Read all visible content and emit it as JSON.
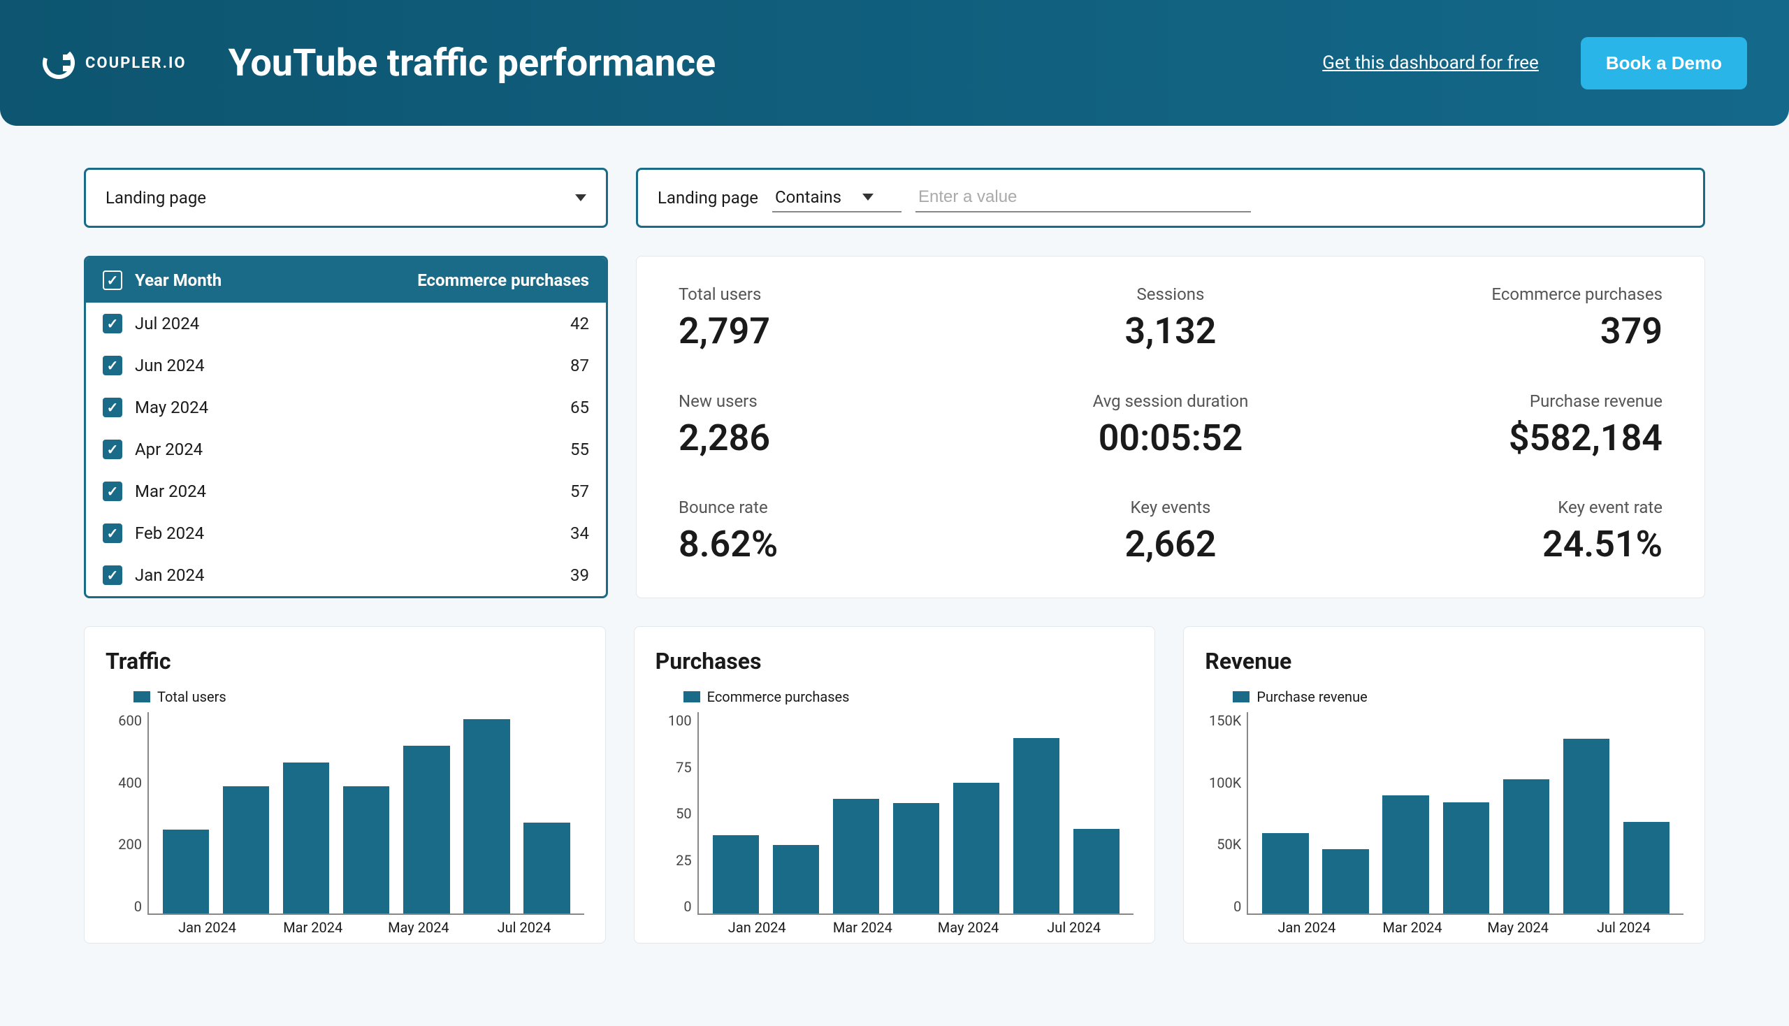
{
  "header": {
    "brand": "COUPLER.IO",
    "title": "YouTube traffic performance",
    "link_label": "Get this dashboard for free",
    "demo_label": "Book a Demo"
  },
  "filters": {
    "dimension_select": "Landing page",
    "condition_dimension": "Landing page",
    "condition_operator": "Contains",
    "condition_placeholder": "Enter a value"
  },
  "month_table": {
    "col_month": "Year Month",
    "col_metric": "Ecommerce purchases",
    "rows": [
      {
        "label": "Jul 2024",
        "value": "42"
      },
      {
        "label": "Jun 2024",
        "value": "87"
      },
      {
        "label": "May 2024",
        "value": "65"
      },
      {
        "label": "Apr 2024",
        "value": "55"
      },
      {
        "label": "Mar 2024",
        "value": "57"
      },
      {
        "label": "Feb 2024",
        "value": "34"
      },
      {
        "label": "Jan 2024",
        "value": "39"
      }
    ]
  },
  "metrics": [
    {
      "label": "Total users",
      "value": "2,797"
    },
    {
      "label": "Sessions",
      "value": "3,132"
    },
    {
      "label": "Ecommerce purchases",
      "value": "379"
    },
    {
      "label": "New users",
      "value": "2,286"
    },
    {
      "label": "Avg session duration",
      "value": "00:05:52"
    },
    {
      "label": "Purchase revenue",
      "value": "$582,184"
    },
    {
      "label": "Bounce rate",
      "value": "8.62%"
    },
    {
      "label": "Key events",
      "value": "2,662"
    },
    {
      "label": "Key event rate",
      "value": "24.51%"
    }
  ],
  "charts": {
    "traffic": {
      "title": "Traffic",
      "legend": "Total users"
    },
    "purchases": {
      "title": "Purchases",
      "legend": "Ecommerce purchases"
    },
    "revenue": {
      "title": "Revenue",
      "legend": "Purchase revenue"
    }
  },
  "chart_data": [
    {
      "type": "bar",
      "title": "Traffic",
      "series_name": "Total users",
      "categories": [
        "Jan 2024",
        "Feb 2024",
        "Mar 2024",
        "Apr 2024",
        "May 2024",
        "Jun 2024",
        "Jul 2024"
      ],
      "values": [
        250,
        380,
        450,
        380,
        500,
        580,
        270
      ],
      "ylim": [
        0,
        600
      ],
      "yticks": [
        0,
        200,
        400,
        600
      ],
      "xlabel": "",
      "ylabel": ""
    },
    {
      "type": "bar",
      "title": "Purchases",
      "series_name": "Ecommerce purchases",
      "categories": [
        "Jan 2024",
        "Feb 2024",
        "Mar 2024",
        "Apr 2024",
        "May 2024",
        "Jun 2024",
        "Jul 2024"
      ],
      "values": [
        39,
        34,
        57,
        55,
        65,
        87,
        42
      ],
      "ylim": [
        0,
        100
      ],
      "yticks": [
        0,
        25,
        50,
        75,
        100
      ],
      "xlabel": "",
      "ylabel": ""
    },
    {
      "type": "bar",
      "title": "Revenue",
      "series_name": "Purchase revenue",
      "categories": [
        "Jan 2024",
        "Feb 2024",
        "Mar 2024",
        "Apr 2024",
        "May 2024",
        "Jun 2024",
        "Jul 2024"
      ],
      "values": [
        60000,
        48000,
        88000,
        83000,
        100000,
        130000,
        68000
      ],
      "ylim": [
        0,
        150000
      ],
      "yticks": [
        0,
        50000,
        100000,
        150000
      ],
      "ytick_labels": [
        "0",
        "50K",
        "100K",
        "150K"
      ],
      "xlabel": "",
      "ylabel": ""
    }
  ]
}
